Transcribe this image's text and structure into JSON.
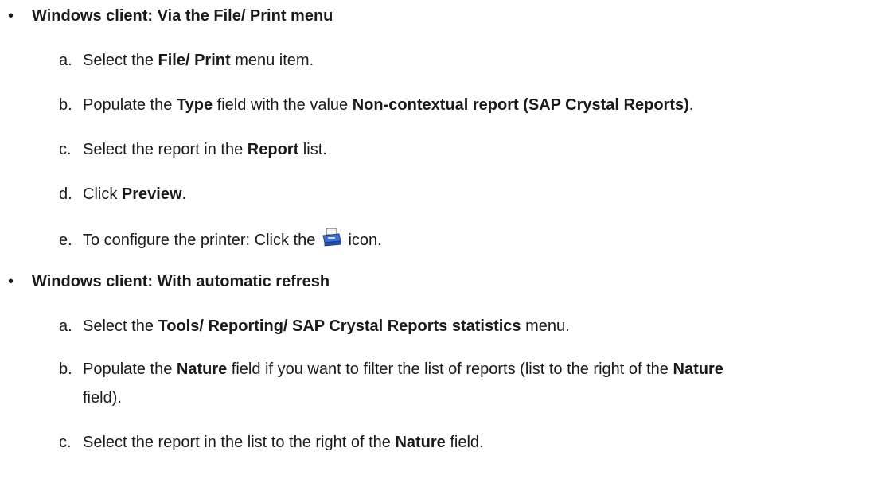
{
  "section1": {
    "title": "Windows client: Via the File/ Print menu",
    "steps": [
      {
        "letter": "a.",
        "p1": "Select the ",
        "b1": "File/ Print",
        "p2": " menu item."
      },
      {
        "letter": "b.",
        "p1": "Populate the ",
        "b1": "Type",
        "p2": " field with the value ",
        "b2": "Non-contextual report (SAP Crystal Reports)",
        "p3": "."
      },
      {
        "letter": "c.",
        "p1": "Select the report in the ",
        "b1": "Report",
        "p2": " list."
      },
      {
        "letter": "d.",
        "p1": "Click ",
        "b1": "Preview",
        "p2": "."
      },
      {
        "letter": "e.",
        "p1": "To configure the printer: Click the ",
        "p2": " icon.",
        "icon": "printer-icon"
      }
    ]
  },
  "section2": {
    "title": "Windows client: With automatic refresh",
    "steps": [
      {
        "letter": "a.",
        "p1": "Select the ",
        "b1": "Tools/ Reporting/ SAP Crystal Reports statistics",
        "p2": " menu."
      },
      {
        "letter": "b.",
        "p1": "Populate the ",
        "b1": "Nature",
        "p2": " field if you want to filter the list of reports (list to the right of the ",
        "b2": "Nature",
        "p3": "field)."
      },
      {
        "letter": "c.",
        "p1": "Select the report in the list to the right of the ",
        "b1": "Nature",
        "p2": " field."
      }
    ]
  }
}
